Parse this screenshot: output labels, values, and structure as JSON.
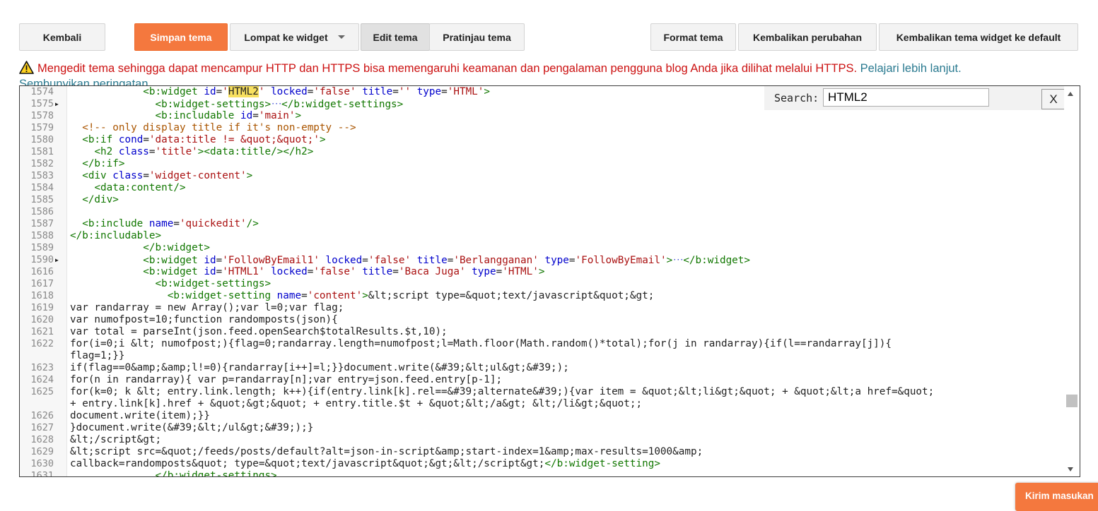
{
  "toolbar": {
    "back_label": "Kembali",
    "save_label": "Simpan tema",
    "jump_label": "Lompat ke widget",
    "edit_label": "Edit tema",
    "preview_label": "Pratinjau tema",
    "format_label": "Format tema",
    "revert_label": "Kembalikan perubahan",
    "reset_widgets_label": "Kembalikan tema widget ke default"
  },
  "warning": {
    "text": "Mengedit tema sehingga dapat mencampur HTTP dan HTTPS bisa memengaruhi keamanan dan pengalaman pengguna blog Anda jika dilihat melalui HTTPS. ",
    "learn_more": "Pelajari lebih lanjut",
    "dot": ".",
    "hide": "Sembunyikan peringatan"
  },
  "search": {
    "label": "Search:",
    "value": "HTML2",
    "close_label": "X"
  },
  "feedback_label": "Kirim masukan",
  "colors": {
    "accent": "#f4783e",
    "warning_text": "#cc1111",
    "link": "#2a7a90",
    "code_tag": "#117700",
    "code_attr": "#0000cc",
    "code_string": "#aa1111",
    "code_comment": "#aa5500"
  },
  "editor": {
    "lines": [
      {
        "num": "1574",
        "fold": false,
        "wrap": false,
        "tokens": [
          [
            "",
            "            "
          ],
          [
            "tag",
            "<b:widget"
          ],
          [
            "",
            " "
          ],
          [
            "attr",
            "id"
          ],
          [
            "",
            "="
          ],
          [
            "str",
            "'"
          ],
          [
            "hl",
            "HTML2"
          ],
          [
            "str",
            "'"
          ],
          [
            "",
            " "
          ],
          [
            "attr",
            "locked"
          ],
          [
            "",
            "="
          ],
          [
            "str",
            "'false'"
          ],
          [
            "",
            " "
          ],
          [
            "attr",
            "title"
          ],
          [
            "",
            "="
          ],
          [
            "str",
            "''"
          ],
          [
            "",
            " "
          ],
          [
            "attr",
            "type"
          ],
          [
            "",
            "="
          ],
          [
            "str",
            "'HTML'"
          ],
          [
            "tag",
            ">"
          ]
        ]
      },
      {
        "num": "1575",
        "fold": true,
        "wrap": false,
        "tokens": [
          [
            "",
            "              "
          ],
          [
            "tag",
            "<b:widget-settings>"
          ],
          [
            "dots",
            "···"
          ],
          [
            "tag",
            "</b:widget-settings>"
          ]
        ]
      },
      {
        "num": "1578",
        "fold": false,
        "wrap": false,
        "tokens": [
          [
            "",
            "              "
          ],
          [
            "tag",
            "<b:includable"
          ],
          [
            "",
            " "
          ],
          [
            "attr",
            "id"
          ],
          [
            "",
            "="
          ],
          [
            "str",
            "'main'"
          ],
          [
            "tag",
            ">"
          ]
        ]
      },
      {
        "num": "1579",
        "fold": false,
        "wrap": false,
        "tokens": [
          [
            "",
            "  "
          ],
          [
            "cmt",
            "<!-- only display title if it's non-empty -->"
          ]
        ]
      },
      {
        "num": "1580",
        "fold": false,
        "wrap": false,
        "tokens": [
          [
            "",
            "  "
          ],
          [
            "tag",
            "<b:if"
          ],
          [
            "",
            " "
          ],
          [
            "attr",
            "cond"
          ],
          [
            "",
            "="
          ],
          [
            "str",
            "'data:title != &quot;&quot;'"
          ],
          [
            "tag",
            ">"
          ]
        ]
      },
      {
        "num": "1581",
        "fold": false,
        "wrap": false,
        "tokens": [
          [
            "",
            "    "
          ],
          [
            "tag",
            "<h2"
          ],
          [
            "",
            " "
          ],
          [
            "attr",
            "class"
          ],
          [
            "",
            "="
          ],
          [
            "str",
            "'title'"
          ],
          [
            "tag",
            ">"
          ],
          [
            "tag",
            "<data:title/>"
          ],
          [
            "tag",
            "</h2>"
          ]
        ]
      },
      {
        "num": "1582",
        "fold": false,
        "wrap": false,
        "tokens": [
          [
            "",
            "  "
          ],
          [
            "tag",
            "</b:if>"
          ]
        ]
      },
      {
        "num": "1583",
        "fold": false,
        "wrap": false,
        "tokens": [
          [
            "",
            "  "
          ],
          [
            "tag",
            "<div"
          ],
          [
            "",
            " "
          ],
          [
            "attr",
            "class"
          ],
          [
            "",
            "="
          ],
          [
            "str",
            "'widget-content'"
          ],
          [
            "tag",
            ">"
          ]
        ]
      },
      {
        "num": "1584",
        "fold": false,
        "wrap": false,
        "tokens": [
          [
            "",
            "    "
          ],
          [
            "tag",
            "<data:content/>"
          ]
        ]
      },
      {
        "num": "1585",
        "fold": false,
        "wrap": false,
        "tokens": [
          [
            "",
            "  "
          ],
          [
            "tag",
            "</div>"
          ]
        ]
      },
      {
        "num": "1586",
        "fold": false,
        "wrap": false,
        "tokens": []
      },
      {
        "num": "1587",
        "fold": false,
        "wrap": false,
        "tokens": [
          [
            "",
            "  "
          ],
          [
            "tag",
            "<b:include"
          ],
          [
            "",
            " "
          ],
          [
            "attr",
            "name"
          ],
          [
            "",
            "="
          ],
          [
            "str",
            "'quickedit'"
          ],
          [
            "tag",
            "/>"
          ]
        ]
      },
      {
        "num": "1588",
        "fold": false,
        "wrap": false,
        "tokens": [
          [
            "tag",
            "</b:includable>"
          ]
        ]
      },
      {
        "num": "1589",
        "fold": false,
        "wrap": false,
        "tokens": [
          [
            "",
            "            "
          ],
          [
            "tag",
            "</b:widget>"
          ]
        ]
      },
      {
        "num": "1590",
        "fold": true,
        "wrap": false,
        "tokens": [
          [
            "",
            "            "
          ],
          [
            "tag",
            "<b:widget"
          ],
          [
            "",
            " "
          ],
          [
            "attr",
            "id"
          ],
          [
            "",
            "="
          ],
          [
            "str",
            "'FollowByEmail1'"
          ],
          [
            "",
            " "
          ],
          [
            "attr",
            "locked"
          ],
          [
            "",
            "="
          ],
          [
            "str",
            "'false'"
          ],
          [
            "",
            " "
          ],
          [
            "attr",
            "title"
          ],
          [
            "",
            "="
          ],
          [
            "str",
            "'Berlangganan'"
          ],
          [
            "",
            " "
          ],
          [
            "attr",
            "type"
          ],
          [
            "",
            "="
          ],
          [
            "str",
            "'FollowByEmail'"
          ],
          [
            "tag",
            ">"
          ],
          [
            "dots",
            "···"
          ],
          [
            "tag",
            "</b:widget>"
          ]
        ]
      },
      {
        "num": "1616",
        "fold": false,
        "wrap": false,
        "tokens": [
          [
            "",
            "            "
          ],
          [
            "tag",
            "<b:widget"
          ],
          [
            "",
            " "
          ],
          [
            "attr",
            "id"
          ],
          [
            "",
            "="
          ],
          [
            "str",
            "'HTML1'"
          ],
          [
            "",
            " "
          ],
          [
            "attr",
            "locked"
          ],
          [
            "",
            "="
          ],
          [
            "str",
            "'false'"
          ],
          [
            "",
            " "
          ],
          [
            "attr",
            "title"
          ],
          [
            "",
            "="
          ],
          [
            "str",
            "'Baca Juga'"
          ],
          [
            "",
            " "
          ],
          [
            "attr",
            "type"
          ],
          [
            "",
            "="
          ],
          [
            "str",
            "'HTML'"
          ],
          [
            "tag",
            ">"
          ]
        ]
      },
      {
        "num": "1617",
        "fold": false,
        "wrap": false,
        "tokens": [
          [
            "",
            "              "
          ],
          [
            "tag",
            "<b:widget-settings>"
          ]
        ]
      },
      {
        "num": "1618",
        "fold": false,
        "wrap": false,
        "tokens": [
          [
            "",
            "                "
          ],
          [
            "tag",
            "<b:widget-setting"
          ],
          [
            "",
            " "
          ],
          [
            "attr",
            "name"
          ],
          [
            "",
            "="
          ],
          [
            "str",
            "'content'"
          ],
          [
            "tag",
            ">"
          ],
          [
            "",
            "&lt;script type=&quot;text/javascript&quot;&gt;"
          ]
        ]
      },
      {
        "num": "1619",
        "fold": false,
        "wrap": false,
        "tokens": [
          [
            "",
            "var randarray = new Array();var l=0;var flag;"
          ]
        ]
      },
      {
        "num": "1620",
        "fold": false,
        "wrap": false,
        "tokens": [
          [
            "",
            "var numofpost=10;function randomposts(json){"
          ]
        ]
      },
      {
        "num": "1621",
        "fold": false,
        "wrap": false,
        "tokens": [
          [
            "",
            "var total = parseInt(json.feed.openSearch$totalResults.$t,10);"
          ]
        ]
      },
      {
        "num": "1622",
        "fold": false,
        "wrap": true,
        "tokens": [
          [
            "",
            "for(i=0;i &lt; numofpost;){flag=0;randarray.length=numofpost;l=Math.floor(Math.random()*total);for(j in randarray){if(l==randarray[j]){\nflag=1;}}"
          ]
        ]
      },
      {
        "num": "1623",
        "fold": false,
        "wrap": false,
        "tokens": [
          [
            "",
            "if(flag==0&amp;&amp;l!=0){randarray[i++]=l;}}document.write(&#39;&lt;ul&gt;&#39;);"
          ]
        ]
      },
      {
        "num": "1624",
        "fold": false,
        "wrap": false,
        "tokens": [
          [
            "",
            "for(n in randarray){ var p=randarray[n];var entry=json.feed.entry[p-1];"
          ]
        ]
      },
      {
        "num": "1625",
        "fold": false,
        "wrap": true,
        "tokens": [
          [
            "",
            "for(k=0; k &lt; entry.link.length; k++){if(entry.link[k].rel==&#39;alternate&#39;){var item = &quot;&lt;li&gt;&quot; + &quot;&lt;a href=&quot;\n+ entry.link[k].href + &quot;&gt;&quot; + entry.title.$t + &quot;&lt;/a&gt; &lt;/li&gt;&quot;;"
          ]
        ]
      },
      {
        "num": "1626",
        "fold": false,
        "wrap": false,
        "tokens": [
          [
            "",
            "document.write(item);}}"
          ]
        ]
      },
      {
        "num": "1627",
        "fold": false,
        "wrap": false,
        "tokens": [
          [
            "",
            "}document.write(&#39;&lt;/ul&gt;&#39;);}"
          ]
        ]
      },
      {
        "num": "1628",
        "fold": false,
        "wrap": false,
        "tokens": [
          [
            "",
            "&lt;/script&gt;"
          ]
        ]
      },
      {
        "num": "1629",
        "fold": false,
        "wrap": false,
        "tokens": [
          [
            "",
            "&lt;script src=&quot;/feeds/posts/default?alt=json-in-script&amp;start-index=1&amp;max-results=1000&amp;"
          ]
        ]
      },
      {
        "num": "1630",
        "fold": false,
        "wrap": false,
        "tokens": [
          [
            "",
            "callback=randomposts&quot; type=&quot;text/javascript&quot;&gt;&lt;/script&gt;"
          ],
          [
            "tag",
            "</b:widget-setting>"
          ]
        ]
      },
      {
        "num": "1631",
        "fold": false,
        "wrap": false,
        "tokens": [
          [
            "",
            "              "
          ],
          [
            "tag",
            "</b:widget-settings>"
          ]
        ]
      }
    ]
  }
}
